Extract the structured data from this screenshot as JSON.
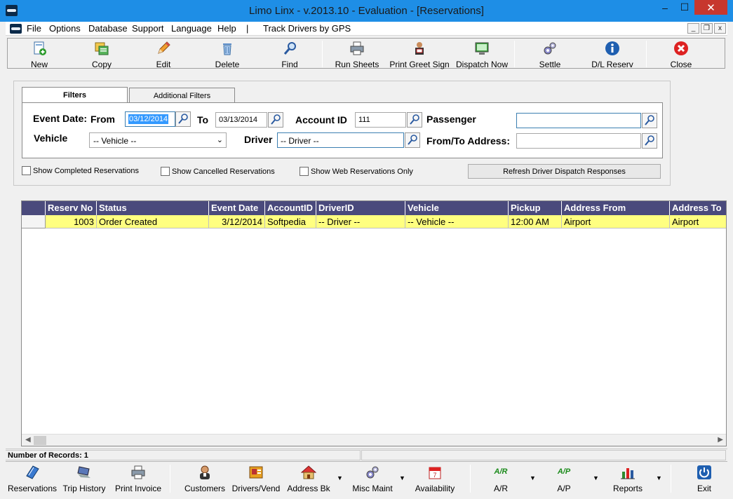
{
  "window": {
    "title": "Limo Linx - v.2013.10 - Evaluation - [Reservations]",
    "min": "–",
    "max": "☐",
    "close": "✕"
  },
  "menu": {
    "items": [
      "File",
      "Options",
      "Database",
      "Support",
      "Language",
      "Help",
      "|",
      "Track Drivers by GPS"
    ],
    "mdi_min": "_",
    "mdi_restore": "❐",
    "mdi_close": "x"
  },
  "toolbar": {
    "new": "New",
    "copy": "Copy",
    "edit": "Edit",
    "delete": "Delete",
    "find": "Find",
    "run_sheets": "Run Sheets",
    "print_greet": "Print Greet Sign",
    "dispatch_now": "Dispatch Now",
    "settle": "Settle",
    "dl_reserv": "D/L Reserv",
    "close": "Close"
  },
  "filters": {
    "tab_filters": "Filters",
    "tab_additional": "Additional Filters",
    "event_date_label": "Event Date:",
    "from_label": "From",
    "from_value": "03/12/2014",
    "to_label": "To",
    "to_value": "03/13/2014",
    "account_label": "Account ID",
    "account_value": "111",
    "passenger_label": "Passenger",
    "passenger_value": "",
    "vehicle_label": "Vehicle",
    "vehicle_value": "-- Vehicle --",
    "driver_label": "Driver",
    "driver_value": "-- Driver --",
    "address_label": "From/To Address:",
    "address_value": ""
  },
  "options": {
    "show_completed": "Show Completed Reservations",
    "show_cancelled": "Show Cancelled Reservations",
    "show_web": "Show Web Reservations Only",
    "refresh": "Refresh Driver Dispatch Responses"
  },
  "grid": {
    "columns": [
      "Reserv No",
      "Status",
      "Event Date",
      "AccountID",
      "DriverID",
      "Vehicle",
      "Pickup",
      "Address From",
      "Address To"
    ],
    "rows": [
      [
        "1003",
        "Order Created",
        "3/12/2014",
        "Softpedia",
        "-- Driver --",
        "-- Vehicle --",
        "12:00 AM",
        "Airport",
        "Airport"
      ]
    ]
  },
  "status": {
    "records": "Number of Records: 1"
  },
  "bottom": {
    "reservations": "Reservations",
    "trip_history": "Trip History",
    "print_invoice": "Print Invoice",
    "customers": "Customers",
    "drivers_vend": "Drivers/Vend",
    "address_bk": "Address Bk",
    "misc_maint": "Misc Maint",
    "availability": "Availability",
    "ar": "A/R",
    "ap": "A/P",
    "reports": "Reports",
    "exit": "Exit",
    "ar_icon_text": "A/R",
    "ap_icon_text": "A/P"
  }
}
